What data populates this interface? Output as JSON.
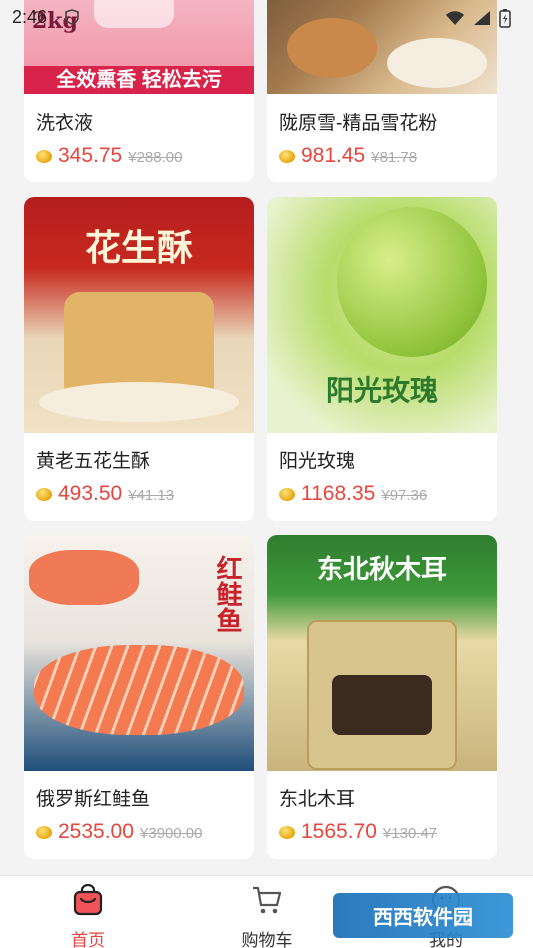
{
  "status_bar": {
    "time": "2:46"
  },
  "products": [
    {
      "name": "洗衣液",
      "price": "345.75",
      "original_price": "¥288.00",
      "image_text": "全效熏香  轻松去污"
    },
    {
      "name": "陇原雪-精品雪花粉",
      "price": "981.45",
      "original_price": "¥81.78",
      "image_text": ""
    },
    {
      "name": "黄老五花生酥",
      "price": "493.50",
      "original_price": "¥41.13",
      "image_text": "花生酥"
    },
    {
      "name": "阳光玫瑰",
      "price": "1168.35",
      "original_price": "¥97.36",
      "image_text": "阳光玫瑰"
    },
    {
      "name": "俄罗斯红鲑鱼",
      "price": "2535.00",
      "original_price": "¥3900.00",
      "image_text": "红鲑鱼"
    },
    {
      "name": "东北木耳",
      "price": "1565.70",
      "original_price": "¥130.47",
      "image_text": "东北秋木耳"
    }
  ],
  "tab_bar": {
    "home": "首页",
    "cart": "购物车",
    "mine": "我的"
  },
  "watermark": "西西软件园"
}
